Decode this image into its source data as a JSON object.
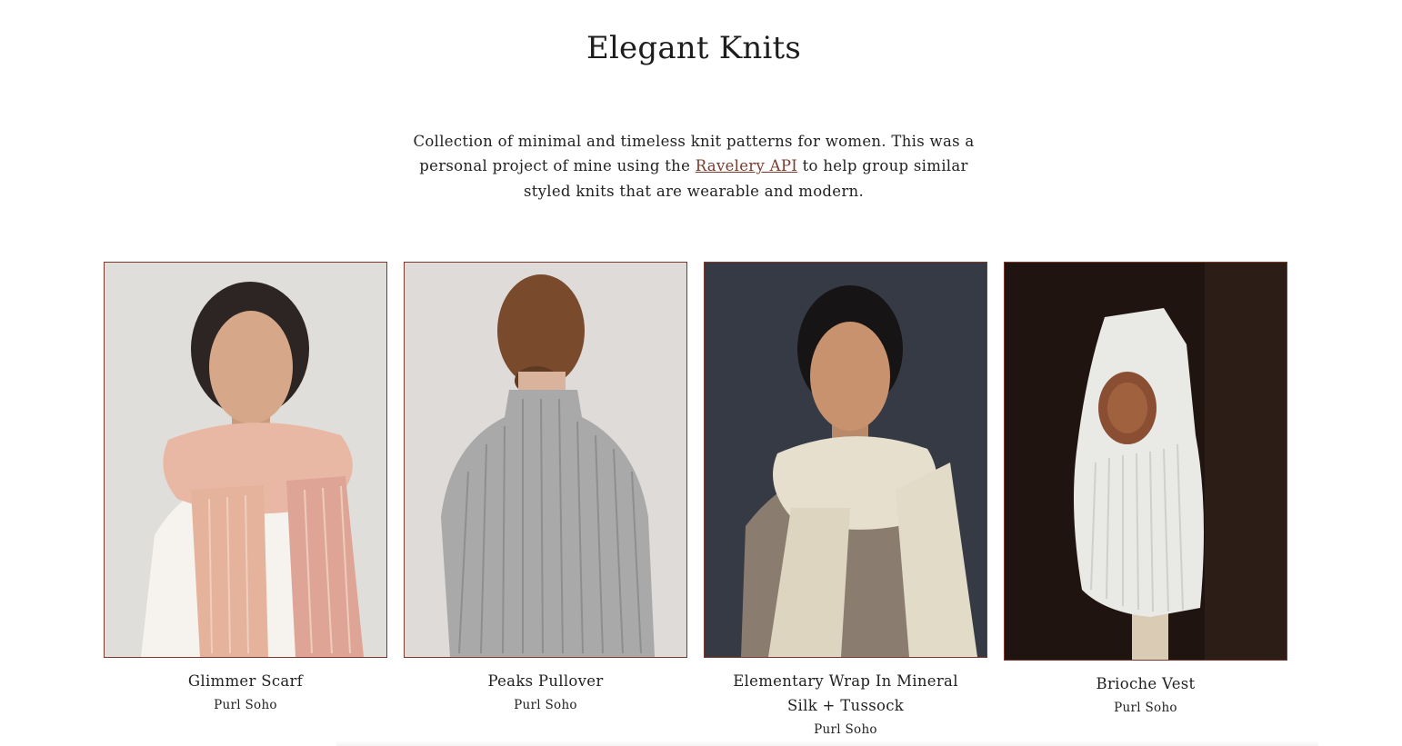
{
  "page": {
    "title": "Elegant Knits",
    "intro_before": "Collection of minimal and timeless knit patterns for women. This was a personal project of mine using the ",
    "intro_link": "Ravelery API",
    "intro_after": " to help group similar styled knits that are wearable and modern."
  },
  "colors": {
    "accent": "#7a3b2e",
    "text": "#222222",
    "background": "#ffffff"
  },
  "patterns": [
    {
      "name": "Glimmer Scarf",
      "designer": "Purl Soho",
      "image": "woman-in-pink-chunky-scarf-photo"
    },
    {
      "name": "Peaks Pullover",
      "designer": "Purl Soho",
      "image": "grey-ribbed-sweater-back-view-photo"
    },
    {
      "name": "Elementary Wrap In Mineral Silk + Tussock",
      "designer": "Purl Soho",
      "image": "woman-in-cream-wrap-photo"
    },
    {
      "name": "Brioche Vest",
      "designer": "Purl Soho",
      "image": "white-brioche-vest-on-dress-form-photo"
    }
  ]
}
